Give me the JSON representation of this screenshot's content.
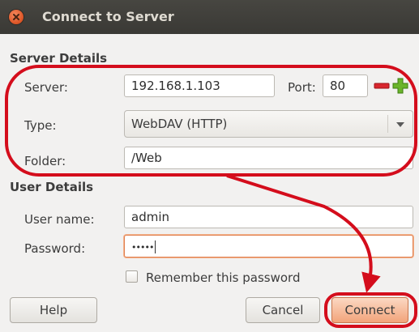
{
  "window": {
    "title": "Connect to Server",
    "close_icon": "close-icon"
  },
  "server_details": {
    "heading": "Server Details",
    "server_label": "Server:",
    "server_value": "192.168.1.103",
    "port_label": "Port:",
    "port_value": "80",
    "decrement_icon": "minus-icon",
    "increment_icon": "plus-icon",
    "type_label": "Type:",
    "type_value": "WebDAV (HTTP)",
    "dropdown_icon": "chevron-down-icon",
    "folder_label": "Folder:",
    "folder_value": "/Web"
  },
  "user_details": {
    "heading": "User Details",
    "username_label": "User name:",
    "username_value": "admin",
    "password_label": "Password:",
    "password_value": "•••••",
    "remember_label": "Remember this password",
    "remember_checked": false
  },
  "buttons": {
    "help": "Help",
    "cancel": "Cancel",
    "connect": "Connect"
  },
  "colors": {
    "annotation_red": "#d40d1c",
    "titlebar": "#3c3b37",
    "focus_orange": "#e08050"
  }
}
